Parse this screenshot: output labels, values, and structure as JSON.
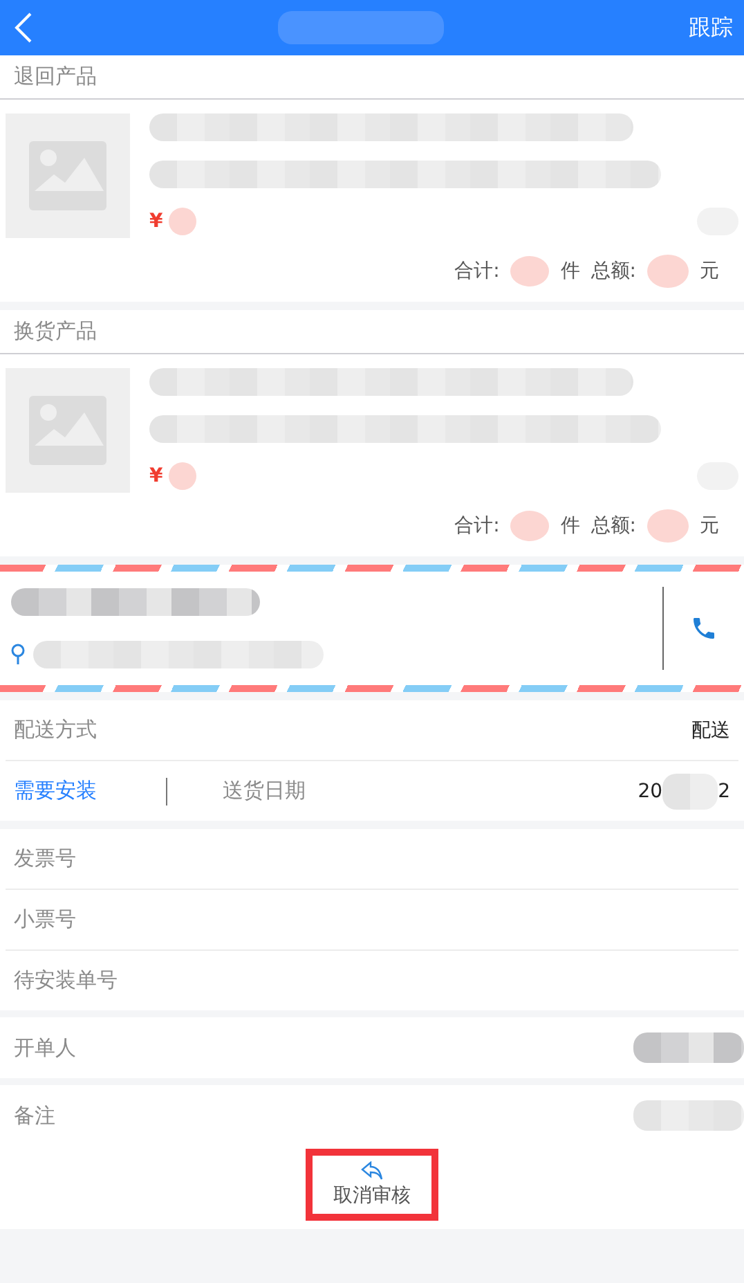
{
  "header": {
    "action": "跟踪"
  },
  "product_sections": [
    {
      "title": "退回产品",
      "currency": "¥",
      "total_label": "合计:",
      "count_unit": "件",
      "amount_label": "总额:",
      "amount_unit": "元"
    },
    {
      "title": "换货产品",
      "currency": "¥",
      "total_label": "合计:",
      "count_unit": "件",
      "amount_label": "总额:",
      "amount_unit": "元"
    }
  ],
  "delivery": {
    "method_label": "配送方式",
    "method_value": "配送",
    "install": {
      "label": "需要安装",
      "selected": true
    },
    "date_label": "送货日期",
    "date_start": "20",
    "date_end": "2"
  },
  "fields": [
    {
      "label": "发票号"
    },
    {
      "label": "小票号"
    },
    {
      "label": "待安装单号"
    }
  ],
  "issuer": {
    "label": "开单人"
  },
  "remark": {
    "label": "备注"
  },
  "action": {
    "label": "取消审核",
    "highlighted": true
  }
}
